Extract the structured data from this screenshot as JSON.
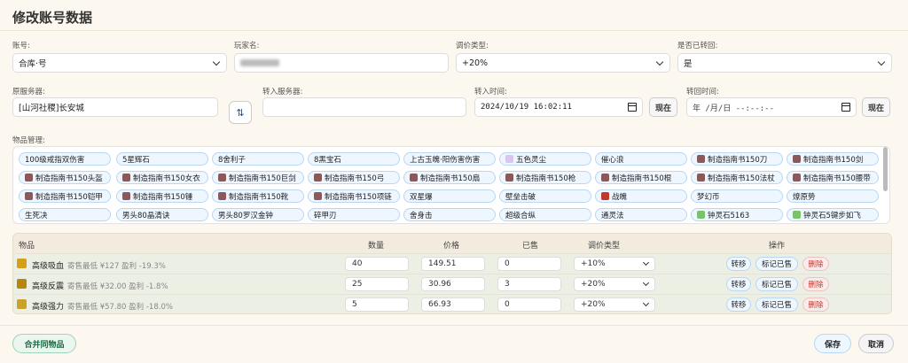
{
  "dialog": {
    "title": "修改账号数据"
  },
  "form": {
    "account_label": "账号:",
    "account_value": "合库·号",
    "player_label": "玩家名:",
    "price_type_label": "调价类型:",
    "price_type_value": "+20%",
    "rebacked_label": "是否已转回:",
    "rebacked_value": "是",
    "orig_server_label": "原服务器:",
    "orig_server_value": "[山河社稷]长安城",
    "target_server_label": "转入服务器:",
    "target_server_value": "",
    "transfer_time_label": "转入时间:",
    "transfer_time_value": "2024/10/19 16:02:11",
    "return_time_label": "转回时间:",
    "return_time_value": "年 /月/日 --:--:--",
    "now_label": "现在",
    "items_label": "物品管理:"
  },
  "items": [
    [
      "100级戒指双伤害",
      "5星辉石",
      "8舍利子",
      "8黑宝石",
      "上古玉魄·阳伤害伤害",
      "五色灵尘",
      "催心浪",
      "制造指南书150刀",
      "制造指南书150剑"
    ],
    [
      "制造指南书150头盔",
      "制造指南书150女衣",
      "制造指南书150巨剑",
      "制造指南书150弓",
      "制造指南书150扇",
      "制造指南书150枪",
      "制造指南书150棍",
      "制造指南书150法杖",
      "制造指南书150腰带"
    ],
    [
      "制造指南书150铠甲",
      "制造指南书150锤",
      "制造指南书150靴",
      "制造指南书150项链",
      "双星爆",
      "壁垒击破",
      "战魄",
      "梦幻币",
      "燎原势"
    ],
    [
      "生死决",
      "男头80晶清诀",
      "男头80罗汉金钟",
      "碎甲刃",
      "舍身击",
      "超级合纵",
      "通灵法",
      "钟灵石5163",
      "钟灵石5键步如飞"
    ]
  ],
  "table": {
    "headers": {
      "item": "物品",
      "qty": "数量",
      "price": "价格",
      "sold": "已售",
      "adjust": "调价类型",
      "ops": "操作"
    },
    "rows": [
      {
        "name": "高级吸血",
        "sub": "寄售最低 ¥127 盈利 -19.3%",
        "qty": "40",
        "price": "149.51",
        "sold": "0",
        "adjust": "+10%"
      },
      {
        "name": "高级反震",
        "sub": "寄售最低 ¥32.00 盈利 -1.8%",
        "qty": "25",
        "price": "30.96",
        "sold": "3",
        "adjust": "+20%"
      },
      {
        "name": "高级强力",
        "sub": "寄售最低 ¥57.80 盈利 -18.0%",
        "qty": "5",
        "price": "66.93",
        "sold": "0",
        "adjust": "+20%"
      }
    ],
    "ops": {
      "transfer": "转移",
      "mark_sold": "标记已售",
      "delete": "删除"
    }
  },
  "footer": {
    "merge": "合并同物品",
    "save": "保存",
    "cancel": "取消"
  },
  "colors": {
    "chip_bg": "#eef6ff",
    "chip_border": "#b9d6f2",
    "delete": "#c0392b",
    "merge": "#1e6b43"
  }
}
